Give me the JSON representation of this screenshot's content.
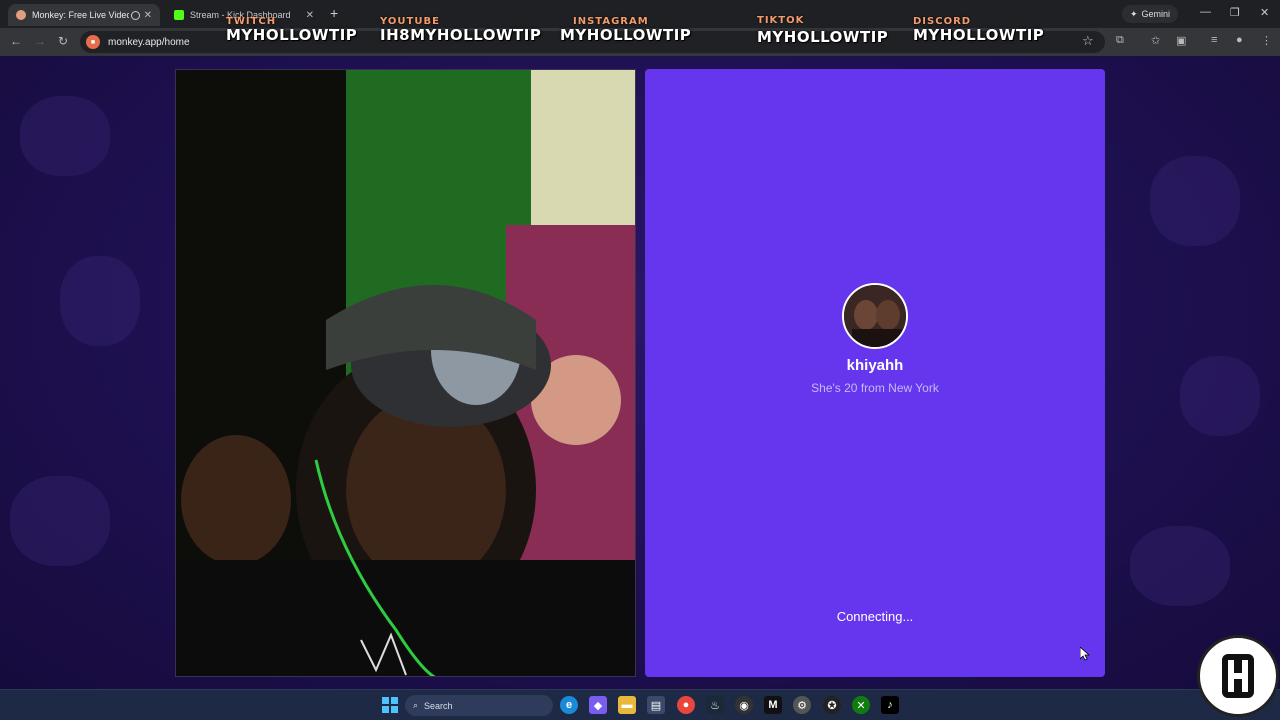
{
  "browser": {
    "tabs": [
      {
        "title": "Monkey: Free Live Video Chat",
        "favicon_color": "#e0a080"
      },
      {
        "title": "Stream - Kick Dashboard",
        "favicon_color": "#53fc18"
      }
    ],
    "new_tab_icon": "plus-icon",
    "gemini_label": "Gemini",
    "url": "monkey.app/home"
  },
  "overlay": {
    "socials": [
      {
        "platform": "TWITCH",
        "handle": "MYHOLLOWTIP"
      },
      {
        "platform": "YOUTUBE",
        "handle": "IH8MYHOLLOWTIP"
      },
      {
        "platform": "INSTAGRAM",
        "handle": "MYHOLLOWTIP"
      },
      {
        "platform": "TIKTOK",
        "handle": "MYHOLLOWTIP"
      },
      {
        "platform": "DISCORD",
        "handle": "MYHOLLOWTIP"
      }
    ]
  },
  "match": {
    "username": "khiyahh",
    "bio": "She's 20 from New York",
    "status": "Connecting..."
  },
  "taskbar": {
    "search_label": "Search"
  },
  "colors": {
    "accent_panel": "#6536ee",
    "page_bg": "#1e1050",
    "overlay_platform": "#f59b6a"
  }
}
